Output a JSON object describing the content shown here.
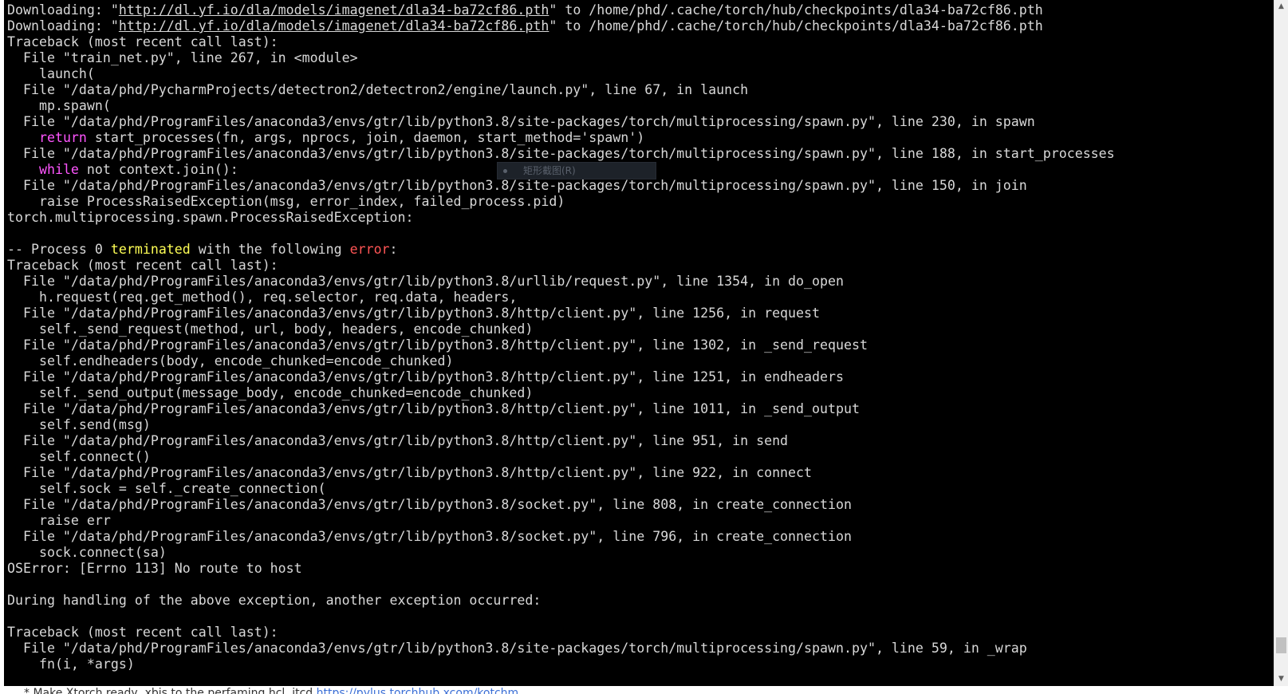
{
  "terminal": {
    "lines": [
      [
        {
          "t": "Downloading: \""
        },
        {
          "t": "http://dl.yf.io/dla/models/imagenet/dla34-ba72cf86.pth",
          "c": "url"
        },
        {
          "t": "\" to /home/phd/.cache/torch/hub/checkpoints/dla34-ba72cf86.pth"
        }
      ],
      [
        {
          "t": "Downloading: \""
        },
        {
          "t": "http://dl.yf.io/dla/models/imagenet/dla34-ba72cf86.pth",
          "c": "url"
        },
        {
          "t": "\" to /home/phd/.cache/torch/hub/checkpoints/dla34-ba72cf86.pth"
        }
      ],
      [
        {
          "t": "Traceback (most recent call last):"
        }
      ],
      [
        {
          "t": "  File \"train_net.py\", line 267, in <module>"
        }
      ],
      [
        {
          "t": "    launch("
        }
      ],
      [
        {
          "t": "  File \"/data/phd/PycharmProjects/detectron2/detectron2/engine/launch.py\", line 67, in launch"
        }
      ],
      [
        {
          "t": "    mp.spawn("
        }
      ],
      [
        {
          "t": "  File \"/data/phd/ProgramFiles/anaconda3/envs/gtr/lib/python3.8/site-packages/torch/multiprocessing/spawn.py\", line 230, in spawn"
        }
      ],
      [
        {
          "t": "    "
        },
        {
          "t": "return",
          "c": "kw"
        },
        {
          "t": " start_processes(fn, args, nprocs, join, daemon, start_method='spawn')"
        }
      ],
      [
        {
          "t": "  File \"/data/phd/ProgramFiles/anaconda3/envs/gtr/lib/python3.8/site-packages/torch/multiprocessing/spawn.py\", line 188, in start_processes"
        }
      ],
      [
        {
          "t": "    "
        },
        {
          "t": "while",
          "c": "kw"
        },
        {
          "t": " not context.join():"
        }
      ],
      [
        {
          "t": "  File \"/data/phd/ProgramFiles/anaconda3/envs/gtr/lib/python3.8/site-packages/torch/multiprocessing/spawn.py\", line 150, in join"
        }
      ],
      [
        {
          "t": "    raise ProcessRaisedException(msg, error_index, failed_process.pid)"
        }
      ],
      [
        {
          "t": "torch.multiprocessing.spawn.ProcessRaisedException:"
        }
      ],
      [
        {
          "t": ""
        }
      ],
      [
        {
          "t": "-- Process 0 "
        },
        {
          "t": "terminated",
          "c": "warn"
        },
        {
          "t": " with the following "
        },
        {
          "t": "error",
          "c": "err"
        },
        {
          "t": ":"
        }
      ],
      [
        {
          "t": "Traceback (most recent call last):"
        }
      ],
      [
        {
          "t": "  File \"/data/phd/ProgramFiles/anaconda3/envs/gtr/lib/python3.8/urllib/request.py\", line 1354, in do_open"
        }
      ],
      [
        {
          "t": "    h.request(req.get_method(), req.selector, req.data, headers,"
        }
      ],
      [
        {
          "t": "  File \"/data/phd/ProgramFiles/anaconda3/envs/gtr/lib/python3.8/http/client.py\", line 1256, in request"
        }
      ],
      [
        {
          "t": "    self._send_request(method, url, body, headers, encode_chunked)"
        }
      ],
      [
        {
          "t": "  File \"/data/phd/ProgramFiles/anaconda3/envs/gtr/lib/python3.8/http/client.py\", line 1302, in _send_request"
        }
      ],
      [
        {
          "t": "    self.endheaders(body, encode_chunked=encode_chunked)"
        }
      ],
      [
        {
          "t": "  File \"/data/phd/ProgramFiles/anaconda3/envs/gtr/lib/python3.8/http/client.py\", line 1251, in endheaders"
        }
      ],
      [
        {
          "t": "    self._send_output(message_body, encode_chunked=encode_chunked)"
        }
      ],
      [
        {
          "t": "  File \"/data/phd/ProgramFiles/anaconda3/envs/gtr/lib/python3.8/http/client.py\", line 1011, in _send_output"
        }
      ],
      [
        {
          "t": "    self.send(msg)"
        }
      ],
      [
        {
          "t": "  File \"/data/phd/ProgramFiles/anaconda3/envs/gtr/lib/python3.8/http/client.py\", line 951, in send"
        }
      ],
      [
        {
          "t": "    self.connect()"
        }
      ],
      [
        {
          "t": "  File \"/data/phd/ProgramFiles/anaconda3/envs/gtr/lib/python3.8/http/client.py\", line 922, in connect"
        }
      ],
      [
        {
          "t": "    self.sock = self._create_connection("
        }
      ],
      [
        {
          "t": "  File \"/data/phd/ProgramFiles/anaconda3/envs/gtr/lib/python3.8/socket.py\", line 808, in create_connection"
        }
      ],
      [
        {
          "t": "    raise err"
        }
      ],
      [
        {
          "t": "  File \"/data/phd/ProgramFiles/anaconda3/envs/gtr/lib/python3.8/socket.py\", line 796, in create_connection"
        }
      ],
      [
        {
          "t": "    sock.connect(sa)"
        }
      ],
      [
        {
          "t": "OSError: [Errno 113] No route to host"
        }
      ],
      [
        {
          "t": ""
        }
      ],
      [
        {
          "t": "During handling of the above exception, another exception occurred:"
        }
      ],
      [
        {
          "t": ""
        }
      ],
      [
        {
          "t": "Traceback (most recent call last):"
        }
      ],
      [
        {
          "t": "  File \"/data/phd/ProgramFiles/anaconda3/envs/gtr/lib/python3.8/site-packages/torch/multiprocessing/spawn.py\", line 59, in _wrap"
        }
      ],
      [
        {
          "t": "    fn(i, *args)"
        }
      ]
    ]
  },
  "context_hint": {
    "label": "矩形截图(R)"
  },
  "scrollbar": {
    "up_icon": "triangle-up-icon",
    "down_icon": "triangle-down-icon",
    "up_glyph": "▲",
    "down_glyph": "▼",
    "position_fraction": 0.97
  },
  "bottom_strip": {
    "text": "* Make Xtorch.ready, xbis to the perfaming.hcl. itcd",
    "link": "https://pylus.torchhub.xcom/kotchm"
  },
  "colors": {
    "terminal_bg": "#000000",
    "terminal_fg": "#d8d8d8",
    "keyword": "#ff55ff",
    "warning": "#ffff55",
    "error": "#ff5555"
  }
}
